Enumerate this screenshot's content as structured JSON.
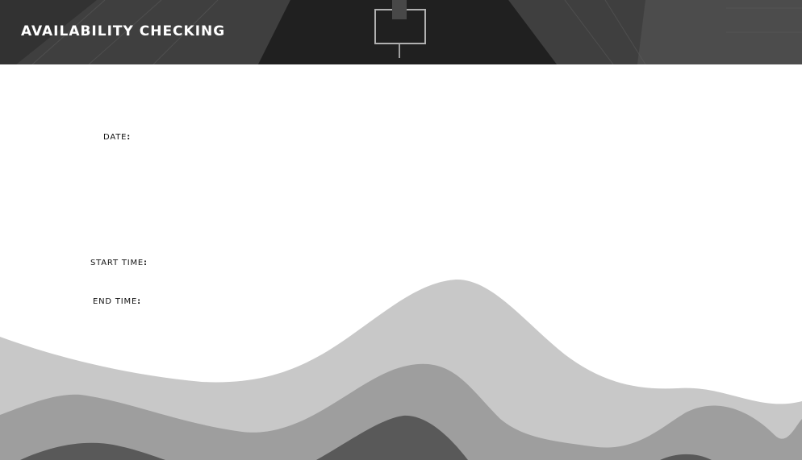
{
  "header": {
    "title": "AVAILABILITY CHECKING"
  },
  "form": {
    "date_label": "DATE",
    "start_time_label": "START TIME",
    "end_time_label": "END TIME",
    "separator": ":"
  },
  "colors": {
    "header_background": "#3a3a3a",
    "wave_light": "#c8c8c8",
    "wave_medium": "#9e9e9e",
    "wave_dark": "#595959",
    "page_background": "#ffffff"
  }
}
